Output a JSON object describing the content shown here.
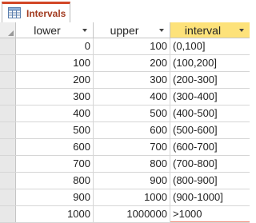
{
  "tab": {
    "label": "Intervals"
  },
  "columns": [
    {
      "label": "lower"
    },
    {
      "label": "upper"
    },
    {
      "label": "interval"
    }
  ],
  "rows": [
    {
      "lower": "0",
      "upper": "100",
      "interval": "(0,100]"
    },
    {
      "lower": "100",
      "upper": "200",
      "interval": "(100,200]"
    },
    {
      "lower": "200",
      "upper": "300",
      "interval": "(200-300]"
    },
    {
      "lower": "300",
      "upper": "400",
      "interval": "(300-400]"
    },
    {
      "lower": "400",
      "upper": "500",
      "interval": "(400-500]"
    },
    {
      "lower": "500",
      "upper": "600",
      "interval": "(500-600]"
    },
    {
      "lower": "600",
      "upper": "700",
      "interval": "(600-700]"
    },
    {
      "lower": "700",
      "upper": "800",
      "interval": "(700-800]"
    },
    {
      "lower": "800",
      "upper": "900",
      "interval": "(800-900]"
    },
    {
      "lower": "900",
      "upper": "1000",
      "interval": "(900-1000]"
    },
    {
      "lower": "1000",
      "upper": "1000000",
      "interval": ">1000"
    }
  ],
  "colors": {
    "tab_accent": "#d24726",
    "selected_header": "#fde27a",
    "grid_line": "#d6d6d6"
  },
  "icons": {
    "tab": "table-icon",
    "column_menu": "dropdown-arrow-icon",
    "select_all": "select-all-corner-icon"
  }
}
